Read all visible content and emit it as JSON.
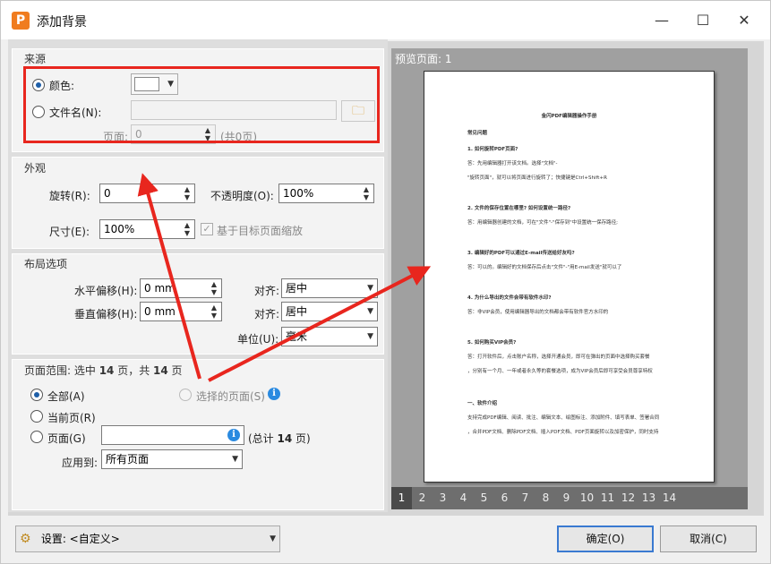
{
  "window": {
    "title": "添加背景",
    "app_icon": "P"
  },
  "source": {
    "heading": "来源",
    "color_label": "颜色:",
    "file_label": "文件名(N):",
    "page_label": "页面:",
    "page_value": "0",
    "page_total": "(共0页)"
  },
  "appearance": {
    "heading": "外观",
    "rotate_label": "旋转(R):",
    "rotate_value": "0",
    "opacity_label": "不透明度(O):",
    "opacity_value": "100%",
    "size_label": "尺寸(E):",
    "size_value": "100%",
    "scale_label": "基于目标页面缩放"
  },
  "layout": {
    "heading": "布局选项",
    "h_offset_label": "水平偏移(H):",
    "h_offset_value": "0 mm",
    "v_offset_label": "垂直偏移(H):",
    "v_offset_value": "0 mm",
    "align1_label": "对齐:",
    "align1_value": "居中",
    "align2_label": "对齐:",
    "align2_value": "居中",
    "unit_label": "单位(U):",
    "unit_value": "毫米"
  },
  "range": {
    "heading_pre": "页面范围: 选中 ",
    "heading_sel": "14",
    "heading_mid": " 页，共 ",
    "heading_total": "14",
    "heading_post": " 页",
    "all_label": "全部(A)",
    "selected_label": "选择的页面(S)",
    "current_label": "当前页(R)",
    "pages_label": "页面(G)",
    "pages_total_pre": "(总计 ",
    "pages_total_num": "14",
    "pages_total_post": " 页)",
    "apply_label": "应用到:",
    "apply_value": "所有页面"
  },
  "preview": {
    "title": "预览页面: 1",
    "doc_title": "金闪PDF编辑器操作手册",
    "lines": [
      {
        "t": "常见问题",
        "b": true
      },
      {
        "t": "1. 如何旋转PDF页面?",
        "b": true
      },
      {
        "t": "答：先用编辑器打开该文档。选择\"文档\"-",
        "b": false
      },
      {
        "t": "\"旋转页面\"，就可以将页面进行旋转了；快捷键是Ctrl+Shift+R",
        "b": false
      },
      {
        "t": "2. 文件的保存位置在哪里? 如何设置统一路径?",
        "b": true
      },
      {
        "t": "答：用编辑器创建的文档，可在\"文件\"-\"保存到\"中设置统一保存路径;",
        "b": false
      },
      {
        "t": "3. 编辑好的PDF可以通过E-mail传送给好友吗?",
        "b": true
      },
      {
        "t": "答：可以的。编辑好的文档保存后点击\"文件\"-\"用E-mail发送\"就可以了",
        "b": false
      },
      {
        "t": "4. 为什么导出的文件会带有软件水印?",
        "b": true
      },
      {
        "t": "答：非VIP会员，使用编辑器导出的文档都会带有软件官方水印的",
        "b": false
      },
      {
        "t": "5. 如何购买VIP会员?",
        "b": true
      },
      {
        "t": "答：打开软件后，点击账户名称，选择开通会员，即可在弹出的页面中选择购买套餐",
        "b": false
      },
      {
        "t": "，分别有一个月、一年或者永久等的套餐选项，成为VIP会员后即可享受会员尊享特权",
        "b": false
      },
      {
        "t": "一、软件介绍",
        "b": true
      },
      {
        "t": "支持完成PDF编辑、阅读、批注、编辑文本、绘图标注、添加附件、填写表单、签署合同",
        "b": false
      },
      {
        "t": "，合并PDF文档、删除PDF文档、插入PDF文档、PDF页面旋转以及加密保护，同时支持",
        "b": false
      }
    ],
    "page_numbers": [
      "1",
      "2",
      "3",
      "4",
      "5",
      "6",
      "7",
      "8",
      "9",
      "10",
      "11",
      "12",
      "13",
      "14"
    ]
  },
  "footer": {
    "settings_label": "设置: <自定义>",
    "ok_label": "确定(O)",
    "cancel_label": "取消(C)"
  },
  "colors": {
    "highlight": "#e8261e",
    "accent": "#1f5fa8"
  }
}
